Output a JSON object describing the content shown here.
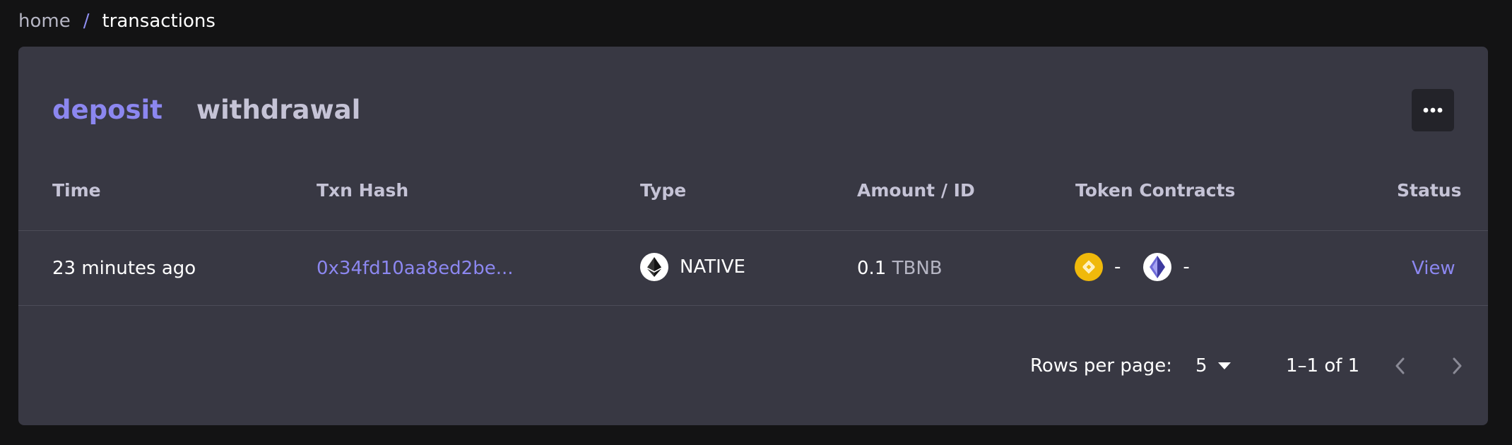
{
  "breadcrumb": {
    "home": "home",
    "separator": "/",
    "current": "transactions"
  },
  "tabs": [
    {
      "label": "deposit",
      "active": true
    },
    {
      "label": "withdrawal",
      "active": false
    }
  ],
  "more_button_icon": "more-horizontal-icon",
  "table": {
    "columns": [
      "Time",
      "Txn Hash",
      "Type",
      "Amount / ID",
      "Token Contracts",
      "Status"
    ],
    "rows": [
      {
        "time": "23 minutes ago",
        "txn_hash": "0x34fd10aa8ed2be...",
        "type_icon": "ethereum-icon",
        "type": "NATIVE",
        "amount_value": "0.1",
        "amount_unit": "TBNB",
        "token_contracts": [
          {
            "icon": "bnb-icon",
            "value": "-"
          },
          {
            "icon": "ethereum-icon",
            "value": "-"
          }
        ],
        "status": "View"
      }
    ]
  },
  "pagination": {
    "rows_per_page_label": "Rows per page:",
    "rows_per_page_value": "5",
    "range": "1–1 of 1"
  },
  "colors": {
    "background": "#131314",
    "card": "#383843",
    "accent": "#8c87f0",
    "muted_text": "#c5c3d6",
    "bnb_yellow": "#f0b90b"
  }
}
